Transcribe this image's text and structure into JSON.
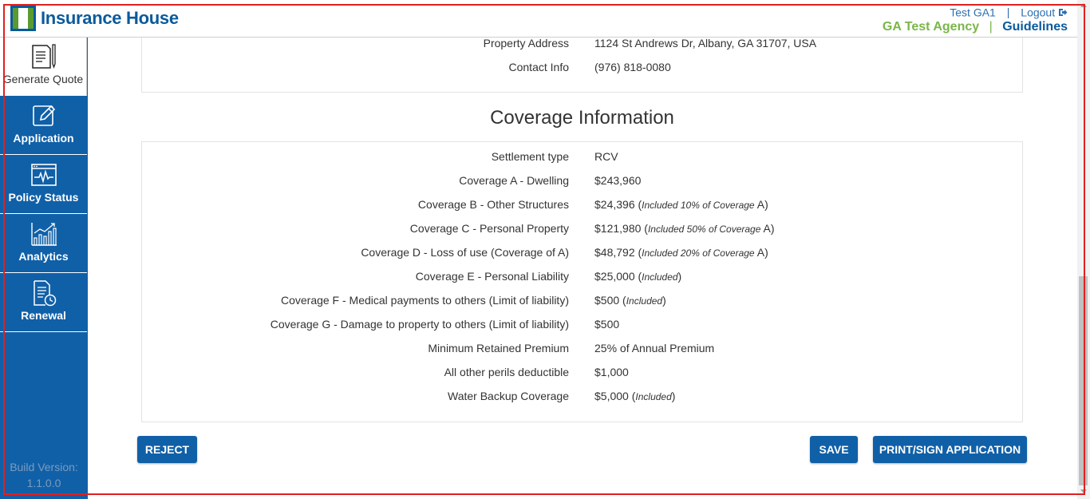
{
  "header": {
    "logo_text": "Insurance House",
    "user": "Test GA1",
    "separator": "|",
    "logout": "Logout",
    "agency": "GA Test Agency",
    "guidelines": "Guidelines"
  },
  "sidebar": {
    "items": [
      {
        "label": "Generate Quote",
        "icon": "document-pen-icon"
      },
      {
        "label": "Application",
        "icon": "edit-icon"
      },
      {
        "label": "Policy Status",
        "icon": "pulse-monitor-icon"
      },
      {
        "label": "Analytics",
        "icon": "bar-chart-icon"
      },
      {
        "label": "Renewal",
        "icon": "document-clock-icon"
      }
    ],
    "build_label": "Build Version:",
    "build_version": "1.1.0.0"
  },
  "property": {
    "rows": [
      {
        "key": "Property Address",
        "value": "1124 St Andrews Dr, Albany, GA 31707, USA"
      },
      {
        "key": "Contact Info",
        "value": "(976) 818-0080"
      }
    ]
  },
  "coverage": {
    "title": "Coverage Information",
    "rows": [
      {
        "key": "Settlement type",
        "value": "RCV",
        "note": ""
      },
      {
        "key": "Coverage A - Dwelling",
        "value": "$243,960",
        "note": ""
      },
      {
        "key": "Coverage B - Other Structures",
        "value": "$24,396",
        "note_pre": "Included 10% of Coverage",
        "note_post": "A"
      },
      {
        "key": "Coverage C - Personal Property",
        "value": "$121,980",
        "note_pre": "Included 50% of Coverage",
        "note_post": "A"
      },
      {
        "key": "Coverage D - Loss of use (Coverage of A)",
        "value": "$48,792",
        "note_pre": "Included 20% of Coverage",
        "note_post": "A"
      },
      {
        "key": "Coverage E - Personal Liability",
        "value": "$25,000",
        "note_pre": "Included",
        "note_post": ""
      },
      {
        "key": "Coverage F - Medical payments to others (Limit of liability)",
        "value": "$500",
        "note_pre": "Included",
        "note_post": ""
      },
      {
        "key": "Coverage G - Damage to property to others (Limit of liability)",
        "value": "$500",
        "note": ""
      },
      {
        "key": "Minimum Retained Premium",
        "value": "25% of Annual Premium",
        "note": ""
      },
      {
        "key": "All other perils deductible",
        "value": "$1,000",
        "note": ""
      },
      {
        "key": "Water Backup Coverage",
        "value": "$5,000",
        "note_pre": "Included",
        "note_post": ""
      }
    ]
  },
  "actions": {
    "reject": "REJECT",
    "save": "SAVE",
    "print_sign": "PRINT/SIGN APPLICATION"
  },
  "colors": {
    "primary": "#1060a8",
    "brand_green": "#7ab648",
    "link_blue": "#2c6fb0"
  }
}
